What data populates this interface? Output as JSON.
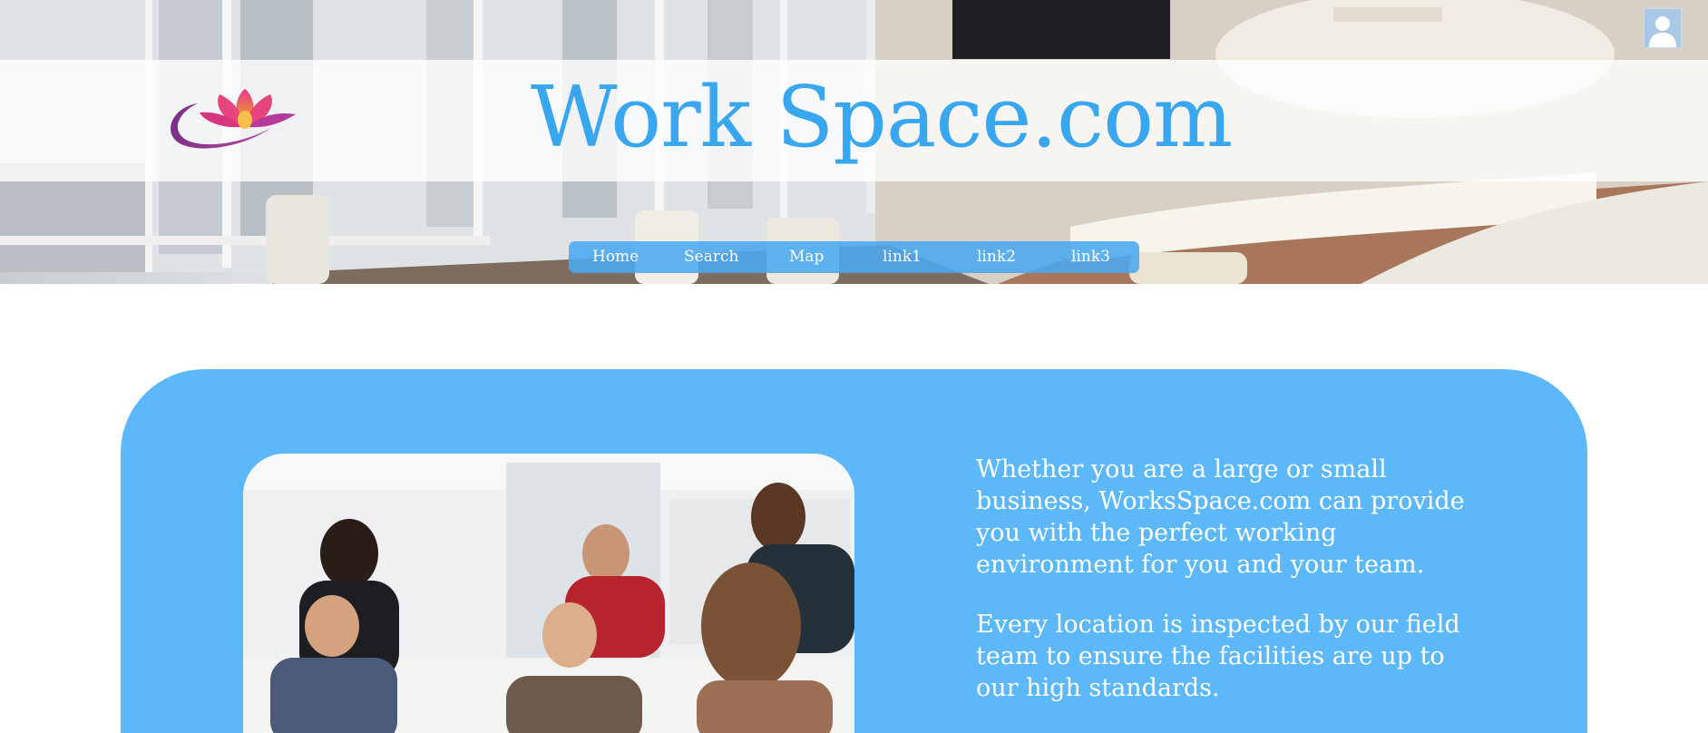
{
  "header": {
    "site_title": "Work Space.com",
    "logo_icon": "lotus-logo-icon",
    "account_icon": "user-avatar-icon"
  },
  "nav": {
    "items": [
      {
        "label": "Home"
      },
      {
        "label": "Search"
      },
      {
        "label": "Map"
      },
      {
        "label": "link1"
      },
      {
        "label": "link2"
      },
      {
        "label": "link3"
      }
    ]
  },
  "content": {
    "paragraph_1": "Whether you are a large or small business, WorksSpace.com can provide you with the perfect working environment for you and your team.",
    "paragraph_2": "Every location is inspected by our field team to ensure the facilities are up to our high standards."
  },
  "colors": {
    "title_blue": "#39a6f0",
    "nav_blue": "#4aa8f0",
    "card_blue": "#5db8fa",
    "avatar_bg": "#a9c8e6"
  }
}
